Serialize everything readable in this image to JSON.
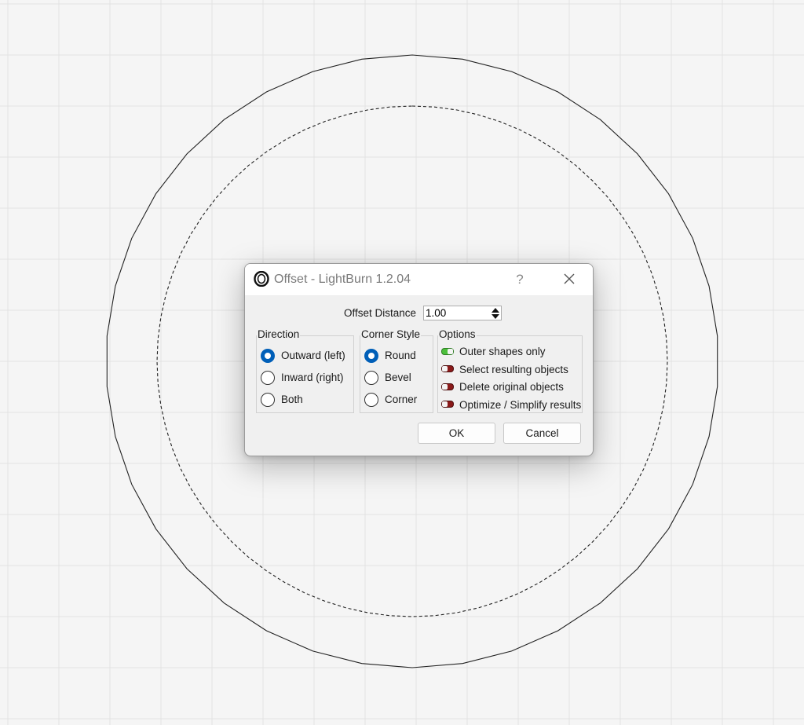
{
  "dialog": {
    "title": "Offset - LightBurn 1.2.04",
    "help_label": "?",
    "offset_distance": {
      "label": "Offset Distance",
      "value": "1.00"
    },
    "direction": {
      "title": "Direction",
      "options": [
        "Outward (left)",
        "Inward (right)",
        "Both"
      ],
      "selected": "Outward (left)"
    },
    "corner_style": {
      "title": "Corner Style",
      "options": [
        "Round",
        "Bevel",
        "Corner"
      ],
      "selected": "Round"
    },
    "options": {
      "title": "Options",
      "items": [
        {
          "label": "Outer shapes only",
          "enabled": true
        },
        {
          "label": "Select resulting objects",
          "enabled": false
        },
        {
          "label": "Delete original objects",
          "enabled": false
        },
        {
          "label": "Optimize / Simplify results",
          "enabled": false
        }
      ]
    },
    "ok_label": "OK",
    "cancel_label": "Cancel"
  },
  "colors": {
    "accent": "#005fb8",
    "toggle_on": "#4cbf3b",
    "toggle_off": "#8b1a1a",
    "grid": "#e2e2e2",
    "workspace": "#f5f5f5"
  }
}
